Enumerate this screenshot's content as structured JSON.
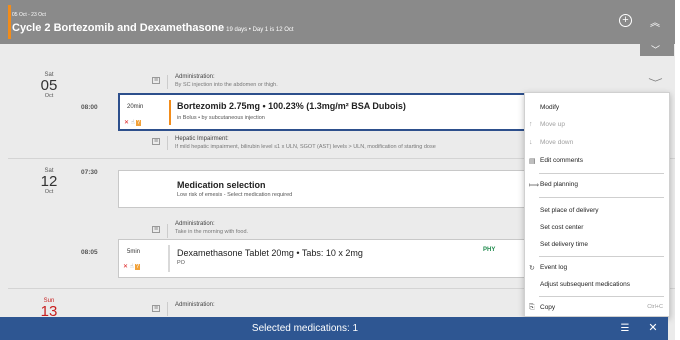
{
  "cycle": {
    "dates": "05 Oct - 23 Oct",
    "title": "Cycle 2 Bortezomib and Dexamethasone",
    "subtitle": "19 days • Day 1 is 12 Oct",
    "add_icon": "plus-circle-icon",
    "collapse_icon": "double-chevron-up-icon",
    "expand_icon": "chevron-down-icon"
  },
  "days": [
    {
      "weekday": "Sat",
      "day": "05",
      "month": "Oct"
    },
    {
      "weekday": "Sat",
      "day": "12",
      "month": "Oct"
    },
    {
      "weekday": "Sun",
      "day": "13",
      "month": ""
    }
  ],
  "rows": {
    "admin1": {
      "title": "Administration:",
      "text": "By SC injection into the abdomen or thigh."
    },
    "med1": {
      "time": "08:00",
      "duration": "20min",
      "name": "Bortezomib 2.75mg • 100.23% (1.3mg/m² BSA Dubois)",
      "route": "in Bolus • by subcutaneous injection",
      "status_x": "✕",
      "status_hand": "☝",
      "status_q": "?"
    },
    "hepatic": {
      "title": "Hepatic Impairment:",
      "text": "If mild hepatic impairment, bilirubin level ≤1 x ULN, SGOT (AST) levels > ULN, modification of starting dose"
    },
    "selection": {
      "time": "07:30",
      "title": "Medication selection",
      "text": "Low risk of emesis - Select medication required"
    },
    "admin2": {
      "title": "Administration:",
      "text": "Take in the morning with food."
    },
    "med2": {
      "time": "08:05",
      "duration": "5min",
      "name": "Dexamethasone Tablet 20mg  • Tabs: 10 x 2mg",
      "route": "PO",
      "badge": "PHY",
      "status_x": "✕",
      "status_hand": "☝",
      "status_q": "?"
    },
    "admin3": {
      "title": "Administration:"
    }
  },
  "menu": {
    "items": [
      {
        "label": "Modify",
        "icon": "",
        "disabled": false
      },
      {
        "label": "Move up",
        "icon": "↑",
        "disabled": true
      },
      {
        "label": "Move down",
        "icon": "↓",
        "disabled": true
      },
      {
        "label": "Edit comments",
        "icon": "▤",
        "disabled": false
      },
      {
        "label": "Bed planning",
        "icon": "⟾",
        "disabled": false
      },
      {
        "label": "Set place of delivery",
        "icon": "",
        "disabled": false
      },
      {
        "label": "Set cost center",
        "icon": "",
        "disabled": false
      },
      {
        "label": "Set delivery time",
        "icon": "",
        "disabled": false
      },
      {
        "label": "Event log",
        "icon": "↻",
        "disabled": false
      },
      {
        "label": "Adjust subsequent medications",
        "icon": "",
        "disabled": false
      },
      {
        "label": "Copy",
        "icon": "⎘",
        "disabled": false,
        "shortcut": "Ctrl+C"
      }
    ]
  },
  "bottom": {
    "selected_text": "Selected medications: 1",
    "list_icon": "list-icon",
    "close_icon": "close-icon"
  },
  "colors": {
    "accent_orange": "#f28c1a",
    "header_gray": "#8a8a8a",
    "selection_blue": "#2d4f8c",
    "bottom_bar": "#2e5692"
  }
}
